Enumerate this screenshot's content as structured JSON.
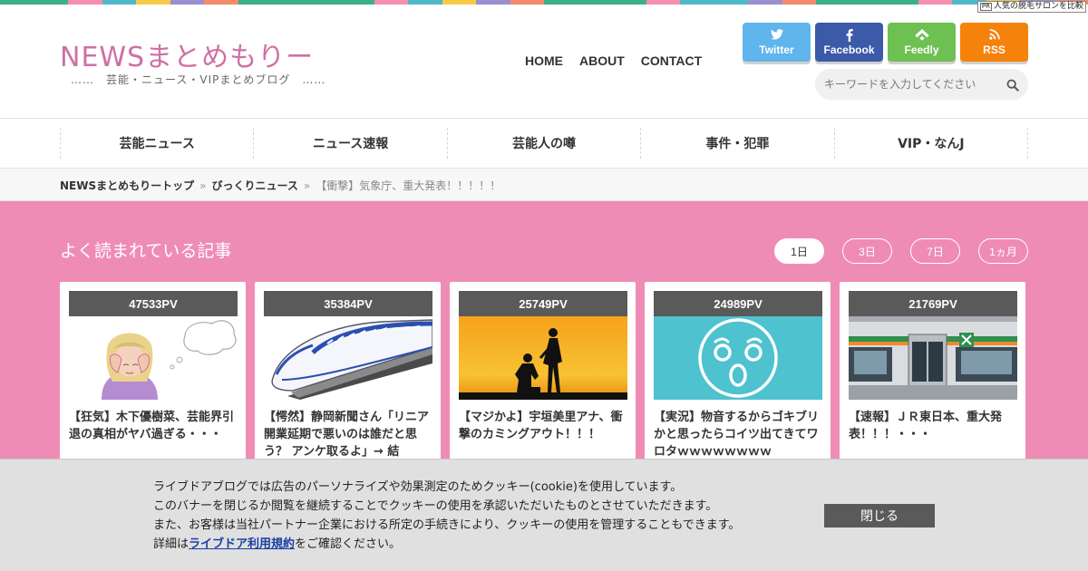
{
  "top_stripe_colors": [
    "#3cb08a",
    "#3cb08a",
    "#f48fb1",
    "#4fb8c8",
    "#f7c948",
    "#9c8fd0",
    "#f28b6b",
    "#3cb08a",
    "#3cb08a",
    "#3cb08a",
    "#3cb08a",
    "#f48fb1",
    "#4fb8c8",
    "#f7c948",
    "#9c8fd0",
    "#f28b6b",
    "#3cb08a",
    "#3cb08a",
    "#3cb08a",
    "#f48fb1",
    "#4fb8c8",
    "#4fb8c8",
    "#9c8fd0",
    "#f28b6b",
    "#3cb08a",
    "#3cb08a",
    "#3cb08a",
    "#f48fb1",
    "#4fb8c8",
    "#f7c948",
    "#9c8fd0",
    "#f28b6b"
  ],
  "ad_corner": {
    "pr": "PR",
    "text": "人気の脱毛サロンを比較"
  },
  "site": {
    "logo": "NEWSまとめもりー",
    "tagline": "……　芸能・ニュース・VIPまとめブログ　……"
  },
  "header_nav": [
    {
      "label": "HOME"
    },
    {
      "label": "ABOUT"
    },
    {
      "label": "CONTACT"
    }
  ],
  "social": {
    "twitter": "Twitter",
    "facebook": "Facebook",
    "feedly": "Feedly",
    "rss": "RSS"
  },
  "search": {
    "placeholder": "キーワードを入力してください"
  },
  "global_nav": [
    {
      "label": "芸能ニュース"
    },
    {
      "label": "ニュース速報"
    },
    {
      "label": "芸能人の噂"
    },
    {
      "label": "事件・犯罪"
    },
    {
      "label": "VIP・なんJ"
    }
  ],
  "breadcrumb": {
    "top": "NEWSまとめもりートップ",
    "category": "びっくりニュース",
    "separator": "»",
    "current": "【衝撃】気象庁、重大発表！！！！！"
  },
  "popular": {
    "title": "よく読まれている記事",
    "tabs": [
      "1日",
      "3日",
      "7日",
      "1ヵ月"
    ],
    "articles": [
      {
        "pv": "47533PV",
        "title": "【狂気】木下優樹菜、芸能界引退の真相がヤバ過ぎる・・・"
      },
      {
        "pv": "35384PV",
        "title": "【愕然】静岡新聞さん「リニア開業延期で悪いのは誰だと思う？ アンケ取るよ」→ 結"
      },
      {
        "pv": "25749PV",
        "title": "【マジかよ】宇垣美里アナ、衝撃のカミングアウト！！！"
      },
      {
        "pv": "24989PV",
        "title": "【実況】物音するからゴキブリかと思ったらコイツ出てきてワロタｗｗｗｗｗｗｗｗ"
      },
      {
        "pv": "21769PV",
        "title": "【速報】ＪＲ東日本、重大発表！！！・・・"
      }
    ]
  },
  "cookie": {
    "line1": "ライブドアブログでは広告のパーソナライズや効果測定のためクッキー(cookie)を使用しています。",
    "line2": "このバナーを閉じるか閲覧を継続することでクッキーの使用を承認いただいたものとさせていただきます。",
    "line3": "また、お客様は当社パートナー企業における所定の手続きにより、クッキーの使用を管理することもできます。",
    "line4_prefix": "詳細は",
    "line4_link": "ライブドア利用規約",
    "line4_suffix": "をご確認ください。",
    "close": "閉じる"
  }
}
